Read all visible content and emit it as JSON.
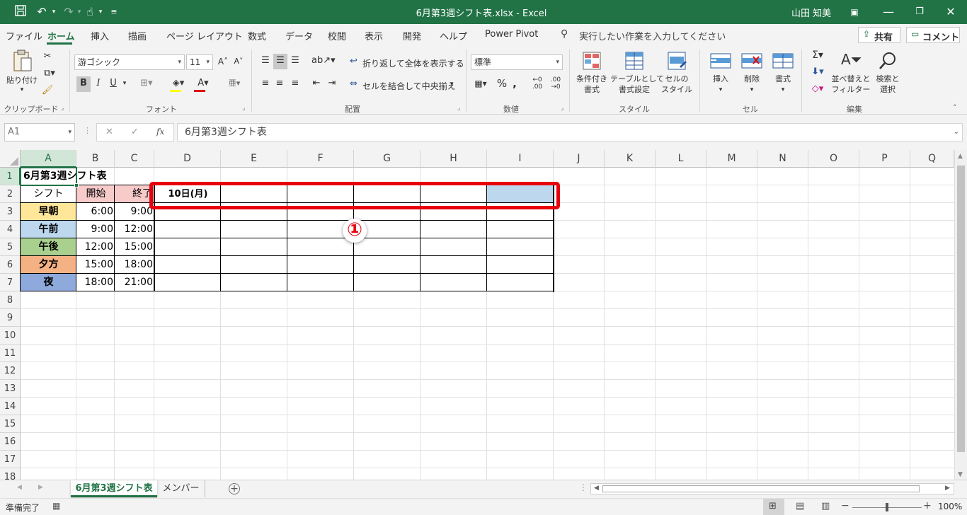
{
  "window": {
    "title": "6月第3週シフト表.xlsx  -  Excel",
    "user": "山田 知美",
    "icons": [
      "save-icon",
      "undo-icon",
      "redo-icon",
      "touch-mode-icon",
      "customize-icon",
      "ribbon-display-icon",
      "minimize-icon",
      "restore-icon",
      "close-icon"
    ]
  },
  "ribbon_tabs": [
    "ファイル",
    "ホーム",
    "挿入",
    "描画",
    "ページ レイアウト",
    "数式",
    "データ",
    "校閲",
    "表示",
    "開発",
    "ヘルプ",
    "Power Pivot"
  ],
  "tell_me": "実行したい作業を入力してください",
  "share_label": "共有",
  "comment_label": "コメント",
  "ribbon": {
    "clipboard": {
      "label": "クリップボード",
      "paste": "貼り付け"
    },
    "font": {
      "label": "フォント",
      "font_name": "游ゴシック",
      "font_size": "11",
      "bold": "B",
      "italic": "I",
      "underline": "U"
    },
    "alignment": {
      "label": "配置",
      "wrap": "折り返して全体を表示する",
      "merge": "セルを結合して中央揃え"
    },
    "number": {
      "label": "数値",
      "format": "標準"
    },
    "styles": {
      "label": "スタイル",
      "conditional_1": "条件付き",
      "conditional_2": "書式",
      "table_1": "テーブルとして",
      "table_2": "書式設定",
      "cell_1": "セルの",
      "cell_2": "スタイル"
    },
    "cells": {
      "label": "セル",
      "insert": "挿入",
      "delete": "削除",
      "format": "書式"
    },
    "editing": {
      "label": "編集",
      "sort_1": "並べ替えと",
      "sort_2": "フィルター",
      "find_1": "検索と",
      "find_2": "選択"
    }
  },
  "formula_bar": {
    "name_box": "A1",
    "fx": "fx",
    "content": "6月第3週シフト表"
  },
  "columns": [
    "A",
    "B",
    "C",
    "D",
    "E",
    "F",
    "G",
    "H",
    "I",
    "J",
    "K",
    "L",
    "M",
    "N",
    "O",
    "P",
    "Q"
  ],
  "rows": [
    "1",
    "2",
    "3",
    "4",
    "5",
    "6",
    "7",
    "8",
    "9",
    "10",
    "11",
    "12",
    "13",
    "14",
    "15",
    "16",
    "17",
    "18"
  ],
  "cells": {
    "A1": "6月第3週シフト表",
    "A2": "シフト",
    "B2": "開始",
    "C2": "終了",
    "D2": "10日(月)",
    "A3": "早朝",
    "B3": "6:00",
    "C3": "9:00",
    "A4": "午前",
    "B4": "9:00",
    "C4": "12:00",
    "A5": "午後",
    "B5": "12:00",
    "C5": "15:00",
    "A6": "夕方",
    "B6": "15:00",
    "C6": "18:00",
    "A7": "夜",
    "B7": "18:00",
    "C7": "21:00"
  },
  "colors": {
    "excel_green": "#217346",
    "header_pink": "#f8cbcb",
    "shift_early": "#ffe699",
    "shift_morning": "#bdd7ee",
    "shift_afternoon": "#a9d08e",
    "shift_evening": "#f4b183",
    "shift_night": "#8ea9db",
    "selected_cell": "#bdd7ee",
    "callout_red": "#e8000b"
  },
  "annotation": {
    "number": "①"
  },
  "sheets": [
    {
      "name": "6月第3週シフト表",
      "active": true
    },
    {
      "name": "メンバー",
      "active": false
    }
  ],
  "status": {
    "ready": "準備完了",
    "zoom": "100%"
  }
}
